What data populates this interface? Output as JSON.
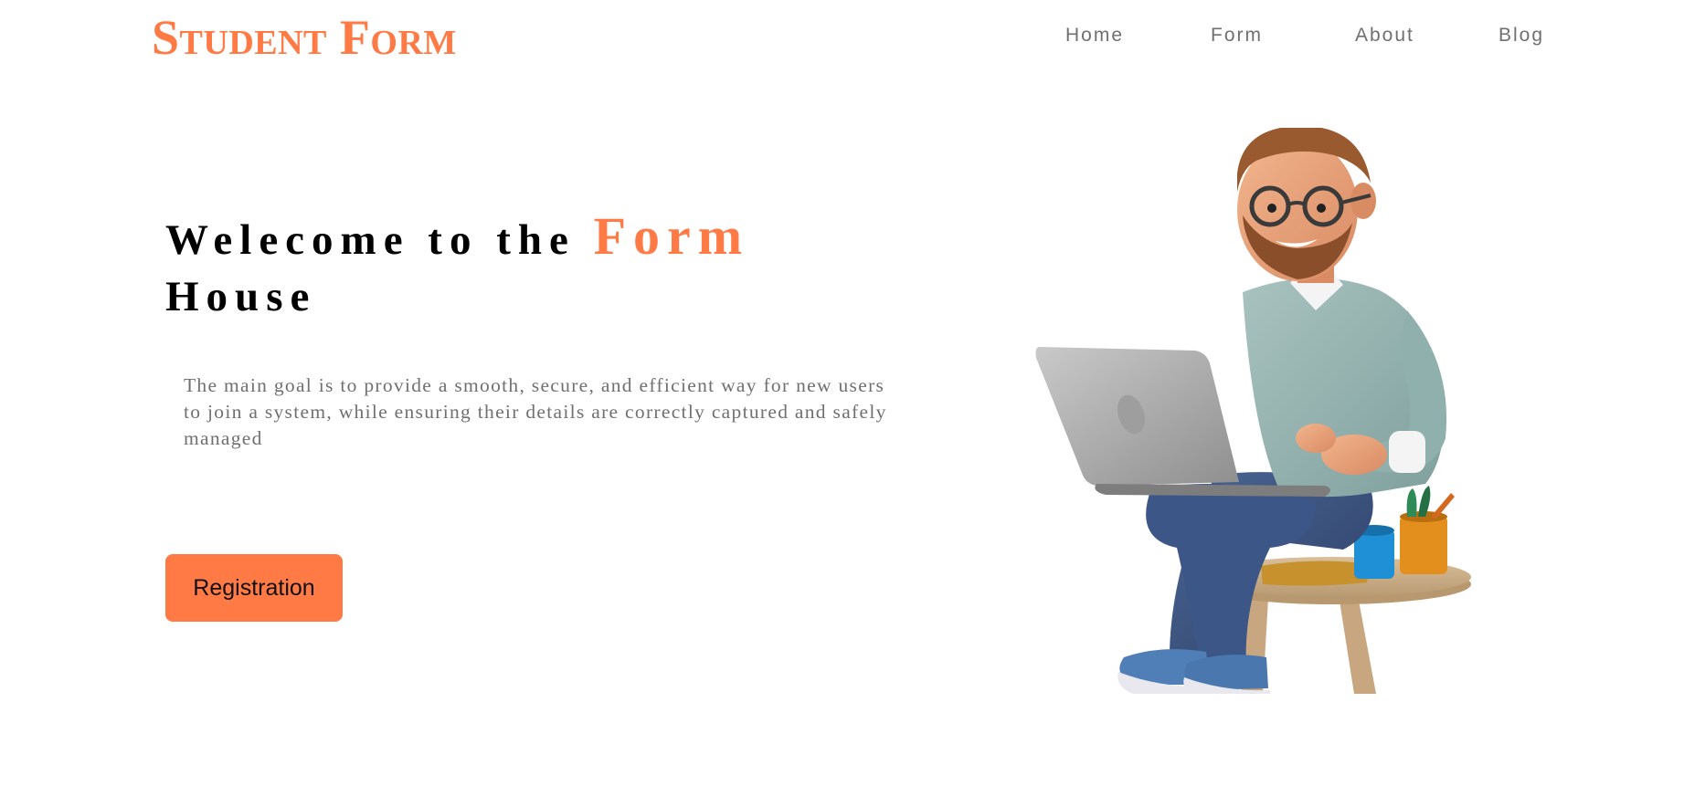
{
  "header": {
    "logo": "Student Form",
    "nav": {
      "home": "Home",
      "form": "Form",
      "about": "About",
      "blog": "Blog"
    }
  },
  "hero": {
    "title_part1": "Welecome to the",
    "title_accent": "Form",
    "title_part2": "House",
    "description": "The main goal is to provide a smooth, secure, and efficient way for new users to join a system, while ensuring their details are correctly captured and safely managed",
    "button_label": "Registration"
  },
  "colors": {
    "accent": "#ff7a45",
    "nav_text": "#707070",
    "body_text": "#707070",
    "heading": "#000000"
  }
}
